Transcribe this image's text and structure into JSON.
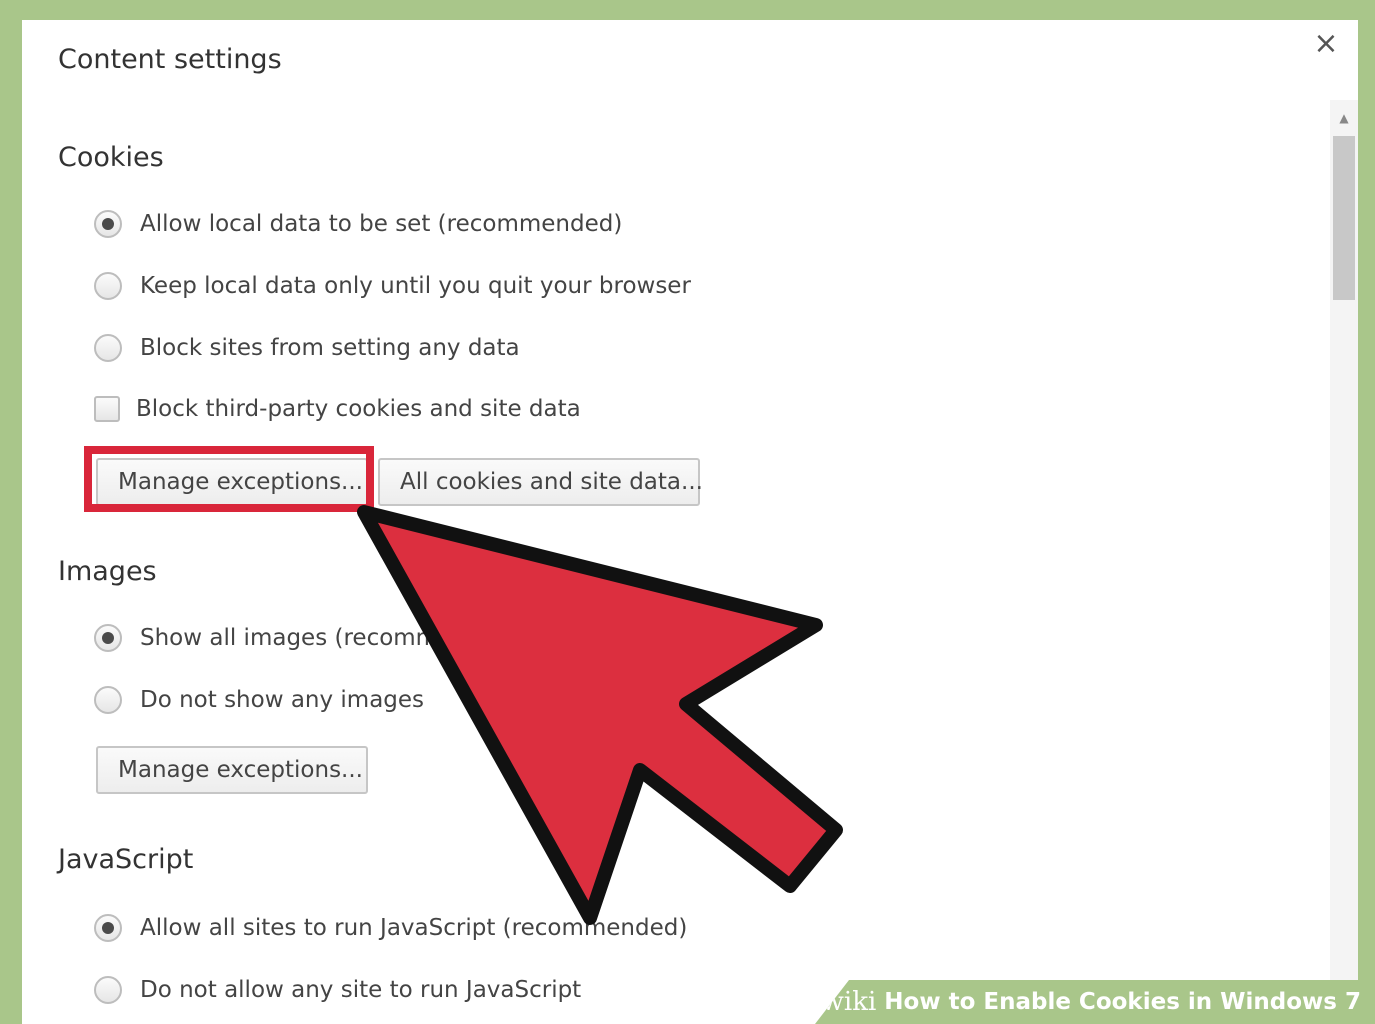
{
  "dialog": {
    "title": "Content settings",
    "close_label": "×"
  },
  "cookies": {
    "heading": "Cookies",
    "options": [
      {
        "label": "Allow local data to be set (recommended)",
        "checked": true
      },
      {
        "label": "Keep local data only until you quit your browser",
        "checked": false
      },
      {
        "label": "Block sites from setting any data",
        "checked": false
      }
    ],
    "checkbox": {
      "label": "Block third-party cookies and site data",
      "checked": false
    },
    "buttons": {
      "manage": "Manage exceptions...",
      "all_cookies": "All cookies and site data..."
    }
  },
  "images": {
    "heading": "Images",
    "options": [
      {
        "label": "Show all images (recommended)",
        "checked": true
      },
      {
        "label": "Do not show any images",
        "checked": false
      }
    ],
    "buttons": {
      "manage": "Manage exceptions..."
    }
  },
  "javascript": {
    "heading": "JavaScript",
    "options": [
      {
        "label": "Allow all sites to run JavaScript (recommended)",
        "checked": true
      },
      {
        "label": "Do not allow any site to run JavaScript",
        "checked": false
      }
    ]
  },
  "overlay": {
    "highlight_color": "#d9263a",
    "arrow_color": "#dc2f3f"
  },
  "watermark": {
    "brand": "wiki",
    "text": "How to Enable Cookies in Windows 7"
  }
}
